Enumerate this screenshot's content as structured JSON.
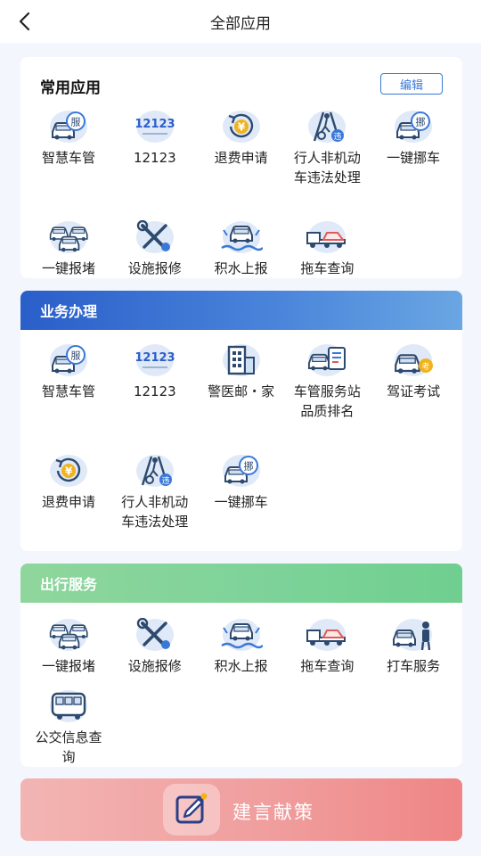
{
  "nav": {
    "title": "全部应用"
  },
  "common": {
    "title": "常用应用",
    "edit_label": "编辑",
    "items": [
      {
        "label": "智慧车管",
        "icon": "car-service-icon"
      },
      {
        "label": "12123",
        "icon": "app-12123-icon"
      },
      {
        "label": "退费申请",
        "icon": "refund-icon"
      },
      {
        "label": "行人非机动车违法处理",
        "icon": "pedestrian-violation-icon"
      },
      {
        "label": "一键挪车",
        "icon": "move-car-icon"
      },
      {
        "label": "一键报堵",
        "icon": "traffic-jam-icon"
      },
      {
        "label": "设施报修",
        "icon": "repair-tools-icon"
      },
      {
        "label": "积水上报",
        "icon": "flood-report-icon"
      },
      {
        "label": "拖车查询",
        "icon": "tow-truck-icon"
      }
    ]
  },
  "business": {
    "title": "业务办理",
    "items": [
      {
        "label": "智慧车管",
        "icon": "car-service-icon"
      },
      {
        "label": "12123",
        "icon": "app-12123-icon"
      },
      {
        "label": "警医邮・家",
        "icon": "building-icon"
      },
      {
        "label": "车管服务站品质排名",
        "icon": "service-station-icon"
      },
      {
        "label": "驾证考试",
        "icon": "driving-exam-icon"
      },
      {
        "label": "退费申请",
        "icon": "refund-icon"
      },
      {
        "label": "行人非机动车违法处理",
        "icon": "pedestrian-violation-icon"
      },
      {
        "label": "一键挪车",
        "icon": "move-car-icon"
      }
    ]
  },
  "travel": {
    "title": "出行服务",
    "items": [
      {
        "label": "一键报堵",
        "icon": "traffic-jam-icon"
      },
      {
        "label": "设施报修",
        "icon": "repair-tools-icon"
      },
      {
        "label": "积水上报",
        "icon": "flood-report-icon"
      },
      {
        "label": "拖车查询",
        "icon": "tow-truck-icon"
      },
      {
        "label": "打车服务",
        "icon": "taxi-service-icon"
      },
      {
        "label": "公交信息查询",
        "icon": "bus-icon"
      }
    ]
  },
  "suggest": {
    "label": "建言献策"
  },
  "colors": {
    "blue_header": "#2a5ec9",
    "green_header": "#7fd39a",
    "icon_dark": "#2d4a6e",
    "icon_accent": "#3a78d8",
    "icon_yellow": "#f2b21b",
    "suggest_bg": "#f09c9c"
  },
  "icon_text": {
    "serve": "服",
    "move": "挪",
    "exam": "考",
    "violation": "违",
    "yen": "¥",
    "brand": "12123"
  }
}
